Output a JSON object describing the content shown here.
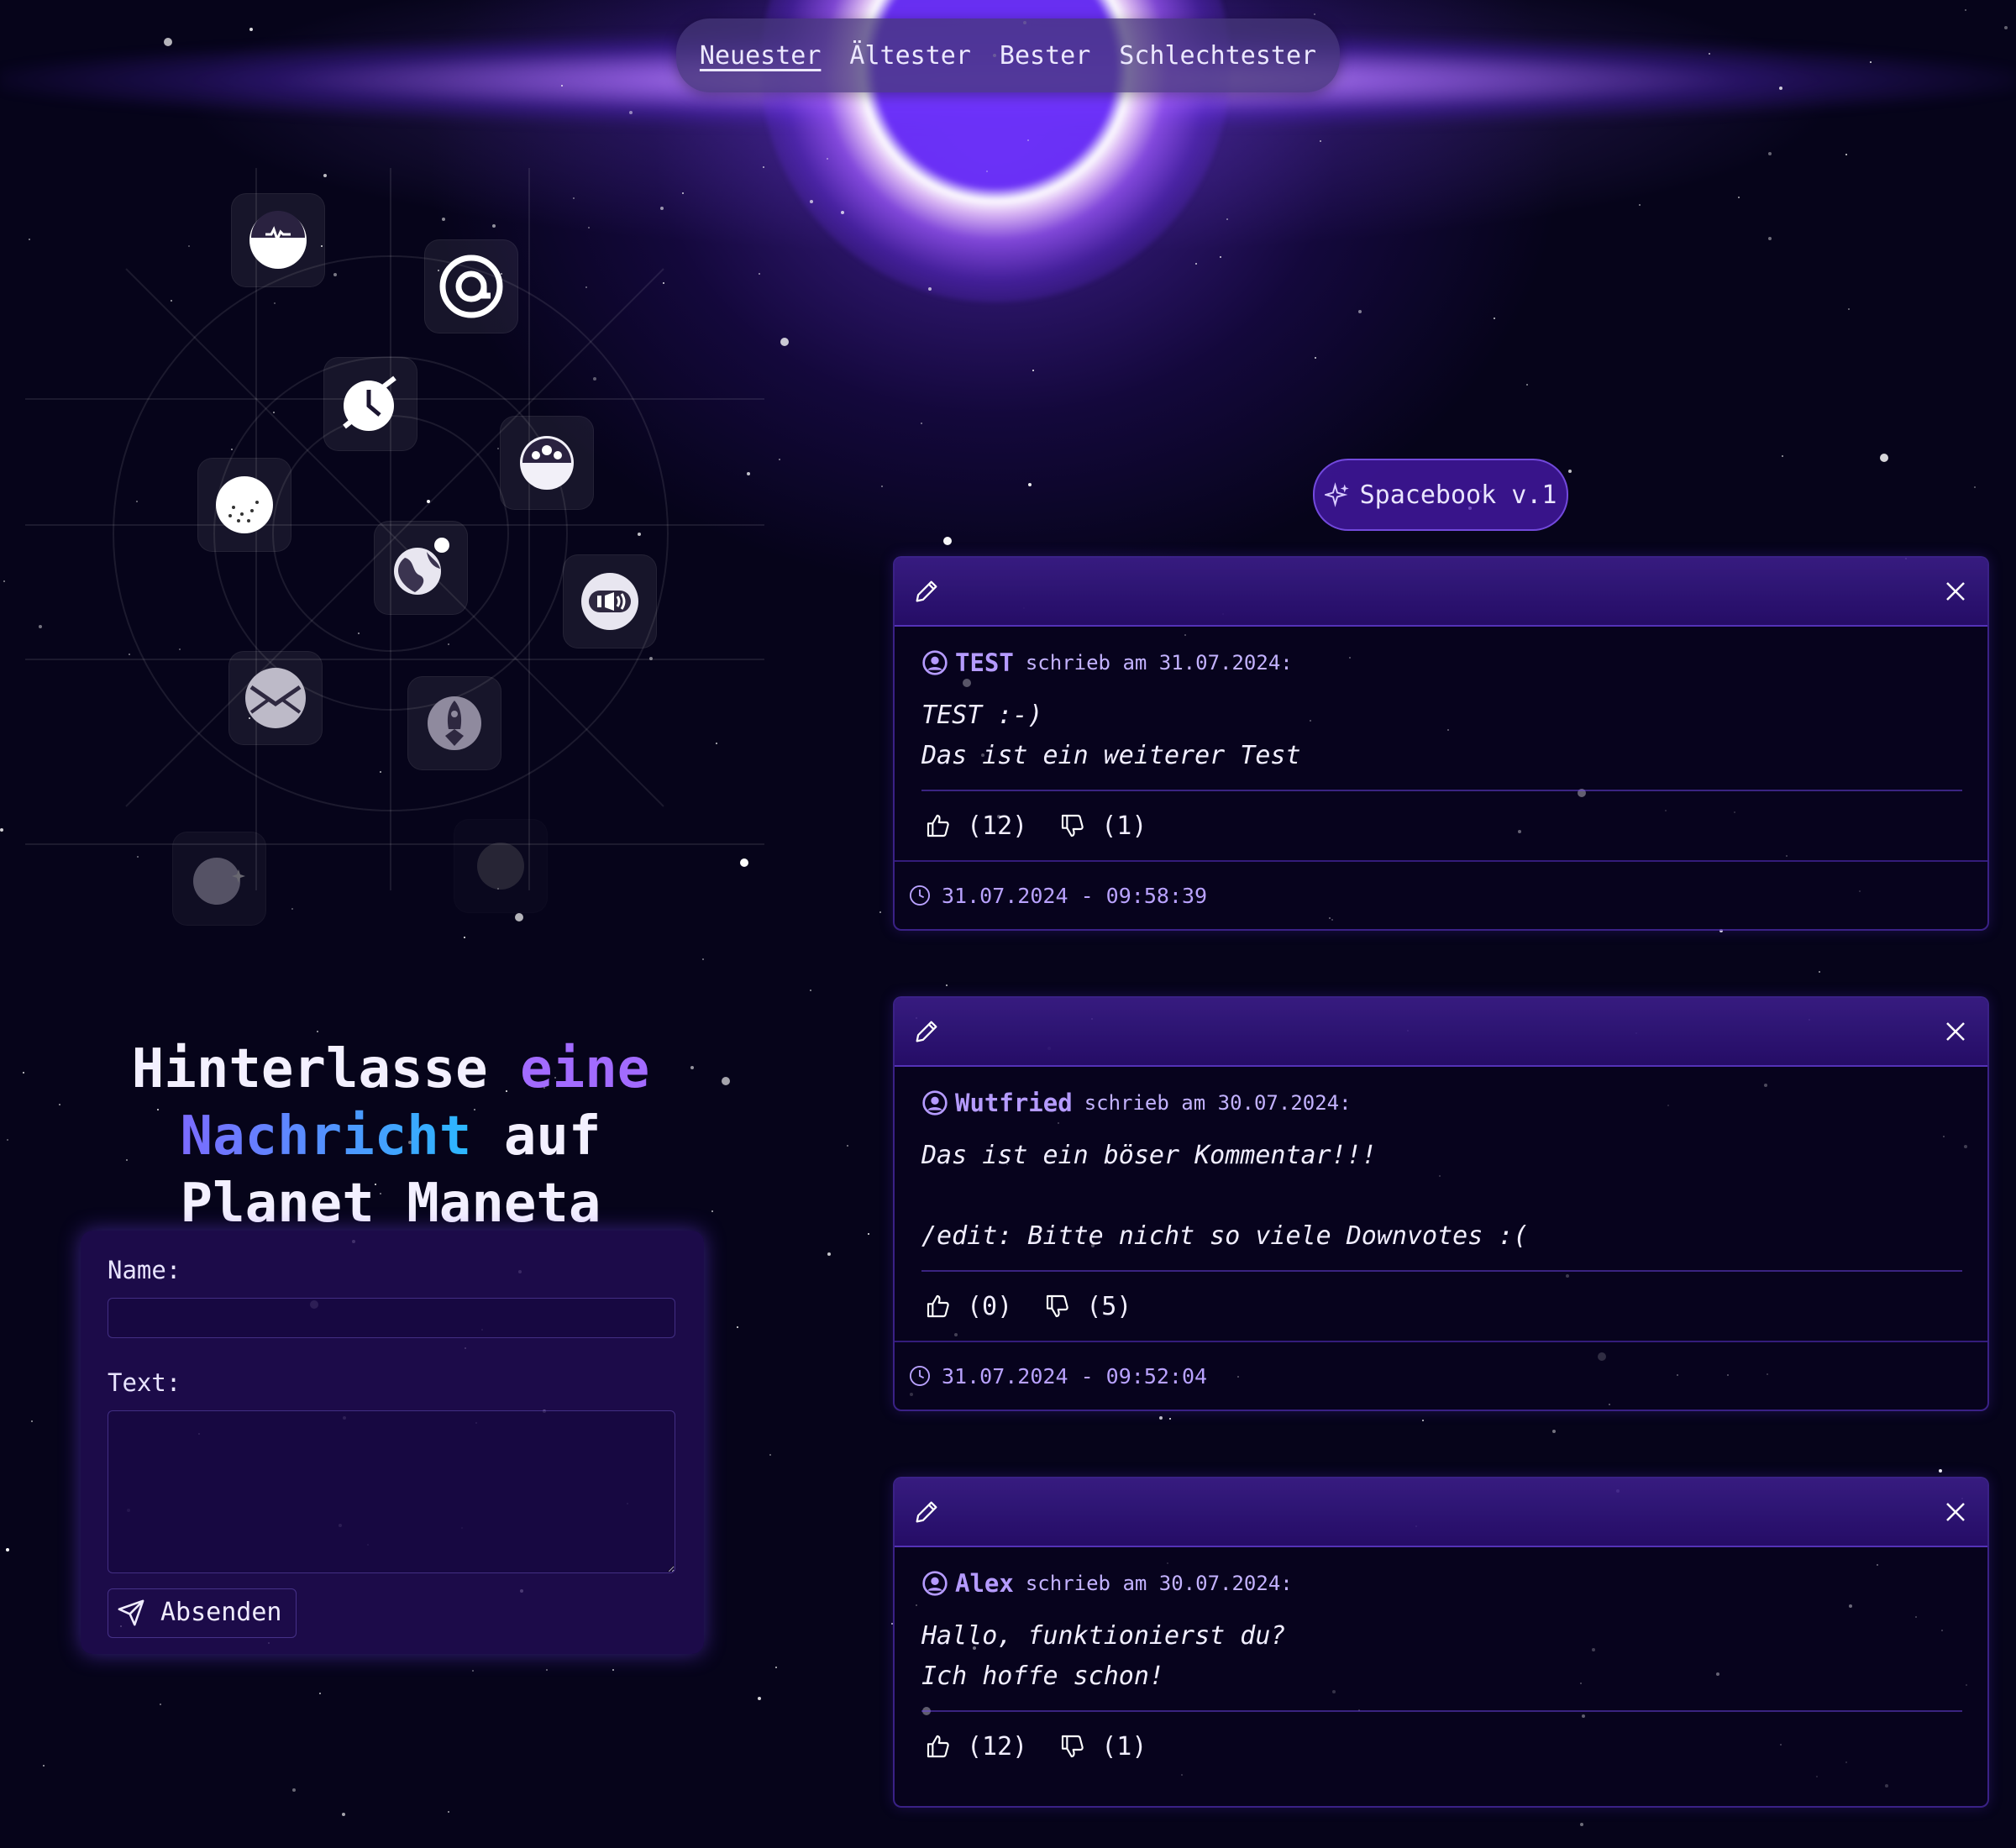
{
  "nav": {
    "items": [
      "Neuester",
      "Ältester",
      "Bester",
      "Schlechtester"
    ]
  },
  "headline": {
    "part1": "Hinterlasse ",
    "part2": "eine",
    "part3": "Nachricht",
    "part4": " auf",
    "part5": "Planet Maneta"
  },
  "form": {
    "name_label": "Name:",
    "name_value": "",
    "text_label": "Text:",
    "text_value": "",
    "submit_label": "Absenden"
  },
  "badge": {
    "label": "Spacebook v.1"
  },
  "posts": [
    {
      "author": "TEST",
      "wrote": "schrieb am 31.07.2024:",
      "message": "TEST :-)\nDas ist ein weiterer Test",
      "upvotes": "(12)",
      "downvotes": "(1)",
      "timestamp": "31.07.2024 - 09:58:39"
    },
    {
      "author": "Wutfried",
      "wrote": "schrieb am 30.07.2024:",
      "message": "Das ist ein böser Kommentar!!!\n\n/edit: Bitte nicht so viele Downvotes :(",
      "upvotes": "(0)",
      "downvotes": "(5)",
      "timestamp": "31.07.2024 - 09:52:04"
    },
    {
      "author": "Alex",
      "wrote": "schrieb am 30.07.2024:",
      "message": "Hallo, funktionierst du?\nIch hoffe schon!",
      "upvotes": "(12)",
      "downvotes": "(1)",
      "timestamp": ""
    }
  ],
  "colors": {
    "background": "#06041a",
    "accent": "#a26bff",
    "card_header": "#3a1a8e",
    "meta": "#b9a2ff"
  }
}
